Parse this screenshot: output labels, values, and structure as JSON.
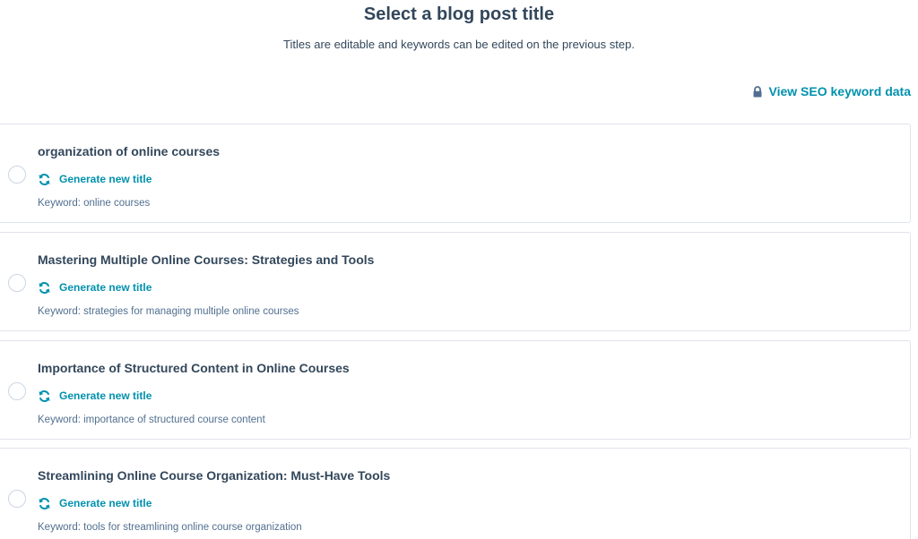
{
  "header": {
    "title": "Select a blog post title",
    "subtitle": "Titles are editable and keywords can be edited on the previous step."
  },
  "seo_link": {
    "label": "View SEO keyword data",
    "icon": "lock-icon"
  },
  "accent_color": "#0091ae",
  "options": [
    {
      "title": "organization of online courses",
      "regenerate_label": "Generate new title",
      "keyword": "Keyword: online courses"
    },
    {
      "title": "Mastering Multiple Online Courses: Strategies and Tools",
      "regenerate_label": "Generate new title",
      "keyword": "Keyword: strategies for managing multiple online courses"
    },
    {
      "title": "Importance of Structured Content in Online Courses",
      "regenerate_label": "Generate new title",
      "keyword": "Keyword: importance of structured course content"
    },
    {
      "title": "Streamlining Online Course Organization: Must-Have Tools",
      "regenerate_label": "Generate new title",
      "keyword": "Keyword: tools for streamlining online course organization"
    }
  ]
}
